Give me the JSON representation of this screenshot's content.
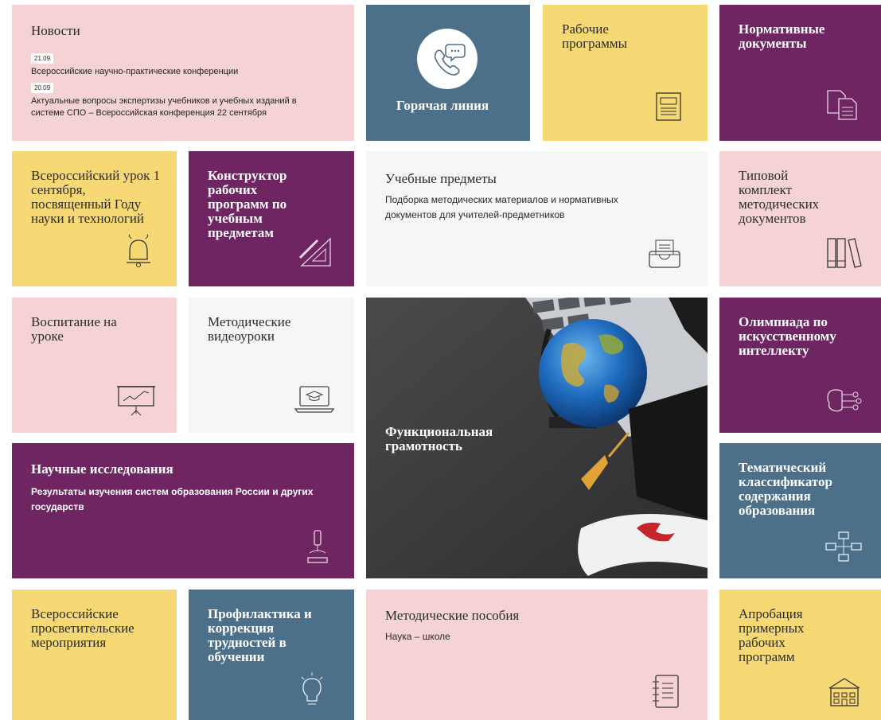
{
  "tiles": {
    "news": {
      "title": "Новости",
      "items": [
        {
          "date": "21.09",
          "text": "Всероссийские научно-практические конференции"
        },
        {
          "date": "20.09",
          "text": "Актуальные вопросы экспертизы учебников и учебных изданий в системе СПО – Всероссийская конференция 22 сентября"
        }
      ]
    },
    "hotline": {
      "title": "Горячая линия",
      "icon": "phone-chat-icon"
    },
    "work_programs": {
      "title": "Рабочие программы",
      "icon": "document-stack-icon"
    },
    "normative_docs": {
      "title": "Нормативные документы",
      "icon": "documents-icon"
    },
    "all_russian_lesson": {
      "title": "Всероссийский урок 1 сентября, посвященный Году науки и технологий",
      "icon": "bell-icon"
    },
    "constructor": {
      "title": "Конструктор рабочих программ по учебным предметам",
      "icon": "ruler-triangle-icon"
    },
    "subjects": {
      "title": "Учебные предметы",
      "description": "Подборка методических материалов и нормативных документов для учителей-предметников",
      "icon": "inbox-icon"
    },
    "typical_set": {
      "title": "Типовой комплект методических документов",
      "icon": "books-icon"
    },
    "upbringing": {
      "title": "Воспитание на уроке",
      "icon": "presentation-chart-icon"
    },
    "video_lessons": {
      "title": "Методические видеоуроки",
      "icon": "laptop-graduation-icon"
    },
    "functional_literacy": {
      "title": "Функциональная грамотность",
      "image": "globe-laptop-graduation-cap-photo"
    },
    "ai_olympiad": {
      "title": "Олимпиада по искусственному интеллекту",
      "icon": "brain-circuit-icon"
    },
    "research": {
      "title": "Научные исследования",
      "description": "Результаты изучения систем образования России и других государств",
      "icon": "microscope-icon"
    },
    "classifier": {
      "title": "Тематический классификатор содержания образования",
      "icon": "hierarchy-icon"
    },
    "enlightenment_events": {
      "title": "Всероссийские просветительские мероприятия"
    },
    "prevention": {
      "title": "Профилактика и коррекция трудностей в обучении",
      "icon": "lightbulb-icon"
    },
    "manuals": {
      "title": "Методические пособия",
      "description": "Наука – школе",
      "icon": "notebook-icon"
    },
    "approbation": {
      "title": "Апробация примерных рабочих программ",
      "icon": "school-building-icon"
    }
  },
  "colors": {
    "pink": "#f5d3d5",
    "blue": "#4c7089",
    "yellow": "#f6d874",
    "purple": "#6e2561",
    "white": "#f6f6f6"
  }
}
